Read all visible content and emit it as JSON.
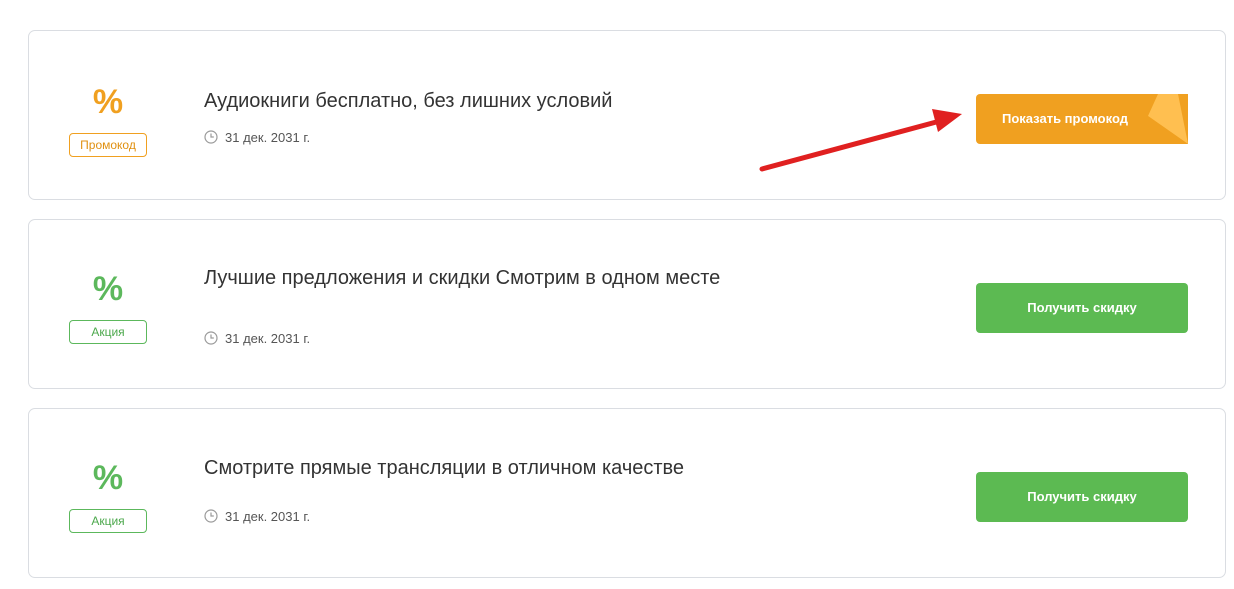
{
  "offers": [
    {
      "symbol": "%",
      "tag": "Промокод",
      "title": "Аудиокниги бесплатно, без лишних условий",
      "date": "31 дек. 2031 г.",
      "button": "Показать промокод",
      "accent": "#f0a020"
    },
    {
      "symbol": "%",
      "tag": "Акция",
      "title": "Лучшие предложения и скидки Смотрим в одном месте",
      "date": "31 дек. 2031 г.",
      "button": "Получить скидку",
      "accent": "#5cb85c"
    },
    {
      "symbol": "%",
      "tag": "Акция",
      "title": "Смотрите прямые трансляции в отличном качестве",
      "date": "31 дек. 2031 г.",
      "button": "Получить скидку",
      "accent": "#5cb85c"
    }
  ],
  "icons": {
    "date": "clock-icon",
    "annotation": "red-arrow-annotation"
  },
  "colors": {
    "promo": "#f0a020",
    "deal": "#5cba52",
    "annotation": "#e02020"
  }
}
